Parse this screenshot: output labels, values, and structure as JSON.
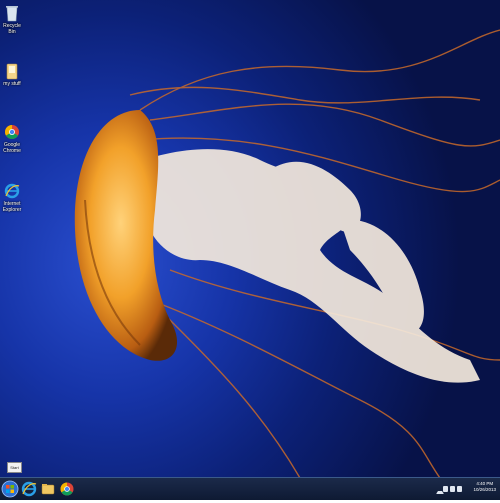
{
  "desktop_icons": [
    {
      "name": "recycle-bin-icon",
      "label": "Recycle Bin"
    },
    {
      "name": "folder-icon",
      "label": "my stuff"
    },
    {
      "name": "chrome-icon",
      "label": "Google Chrome"
    },
    {
      "name": "ie-icon",
      "label": "Internet Explorer"
    }
  ],
  "taskbar": {
    "buttons": [
      "start-orb-icon",
      "ie-icon",
      "explorer-folder-icon",
      "chrome-icon"
    ],
    "tooltip": "Start",
    "clock": {
      "time": "4:40 PM",
      "date": "10/26/2013"
    },
    "tray_icons": [
      "show-hidden-icon",
      "flag-icon",
      "network-icon",
      "volume-icon"
    ]
  },
  "colors": {
    "accent": "#1634a8",
    "taskbar": "#0e1a33"
  }
}
